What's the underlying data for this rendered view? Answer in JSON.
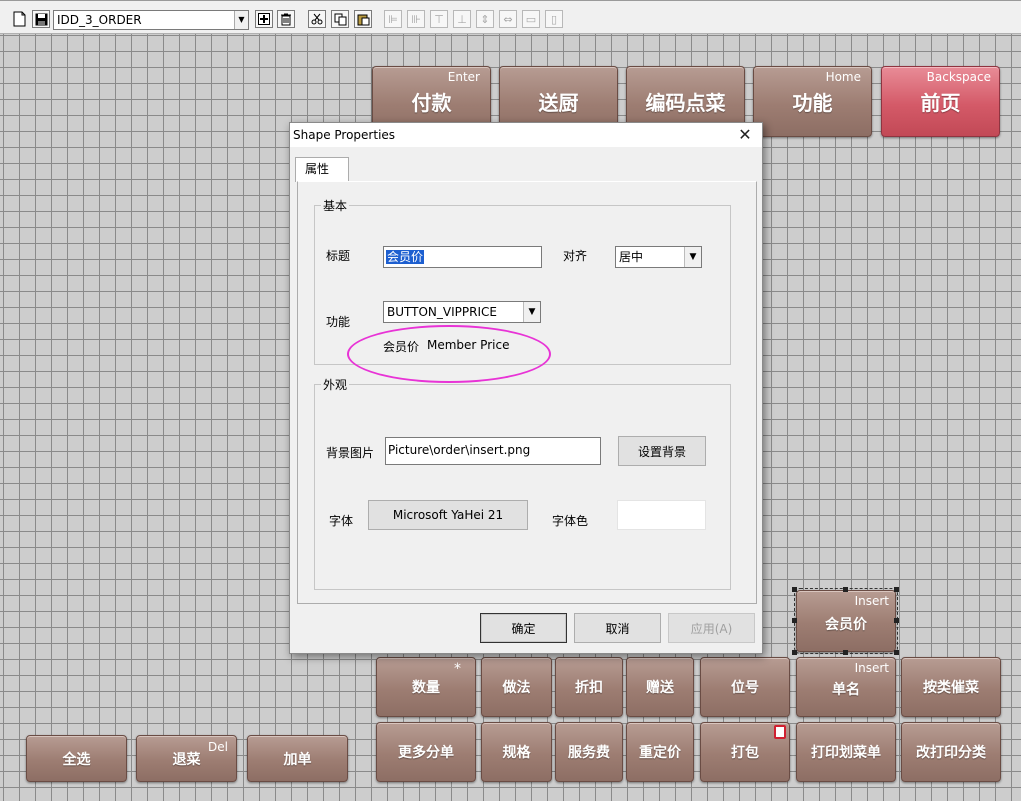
{
  "toolbar": {
    "layout_name": "IDD_3_ORDER",
    "icons": [
      "new-document-icon",
      "save-icon",
      "add-icon",
      "delete-icon",
      "cut-icon",
      "copy-icon",
      "paste-icon",
      "align-left-icon",
      "align-right-icon",
      "align-top-icon",
      "align-bottom-icon",
      "center-vertical-icon",
      "center-horizontal-icon",
      "same-width-icon",
      "same-height-icon"
    ]
  },
  "top_buttons": [
    {
      "label": "付款",
      "hotkey": "Enter"
    },
    {
      "label": "送厨",
      "hotkey": ""
    },
    {
      "label": "编码点菜",
      "hotkey": ""
    },
    {
      "label": "功能",
      "hotkey": "Home"
    },
    {
      "label": "前页",
      "hotkey": "Backspace"
    }
  ],
  "vip_button": {
    "label": "会员价",
    "hotkey": "Insert"
  },
  "row1_buttons": [
    {
      "label": "数量",
      "hotkey": "*"
    },
    {
      "label": "做法",
      "hotkey": ""
    },
    {
      "label": "折扣",
      "hotkey": ""
    },
    {
      "label": "赠送",
      "hotkey": ""
    },
    {
      "label": "位号",
      "hotkey": ""
    },
    {
      "label": "单名",
      "hotkey": "Insert"
    },
    {
      "label": "按类催菜",
      "hotkey": ""
    }
  ],
  "row2_buttons": [
    {
      "label": "更多分单"
    },
    {
      "label": "规格"
    },
    {
      "label": "服务费"
    },
    {
      "label": "重定价"
    },
    {
      "label": "打包"
    },
    {
      "label": "打印划菜单"
    },
    {
      "label": "改打印分类"
    }
  ],
  "left_buttons": [
    {
      "label": "全选",
      "hotkey": ""
    },
    {
      "label": "退菜",
      "hotkey": "Del"
    },
    {
      "label": "加单",
      "hotkey": ""
    }
  ],
  "dialog": {
    "title": "Shape Properties",
    "close_glyph": "✕",
    "tab_label": "属性",
    "basic_group": "基本",
    "title_label": "标题",
    "title_value": "会员价",
    "align_label": "对齐",
    "align_value": "居中",
    "function_label": "功能",
    "function_value": "BUTTON_VIPPRICE",
    "function_desc_cn": "会员价",
    "function_desc_en": "Member Price",
    "appearance_group": "外观",
    "bg_image_label": "背景图片",
    "bg_image_value": "Picture\\order\\insert.png",
    "set_bg_button": "设置背景",
    "font_label": "字体",
    "font_button": "Microsoft YaHei 21",
    "font_color_label": "字体色",
    "ok_button": "确定",
    "cancel_button": "取消",
    "apply_button": "应用(A)"
  },
  "colors": {
    "button_brown": "#9d7d72",
    "button_red": "#d45a68",
    "annotation": "#e833d6",
    "selection": "#1d5fd0"
  }
}
